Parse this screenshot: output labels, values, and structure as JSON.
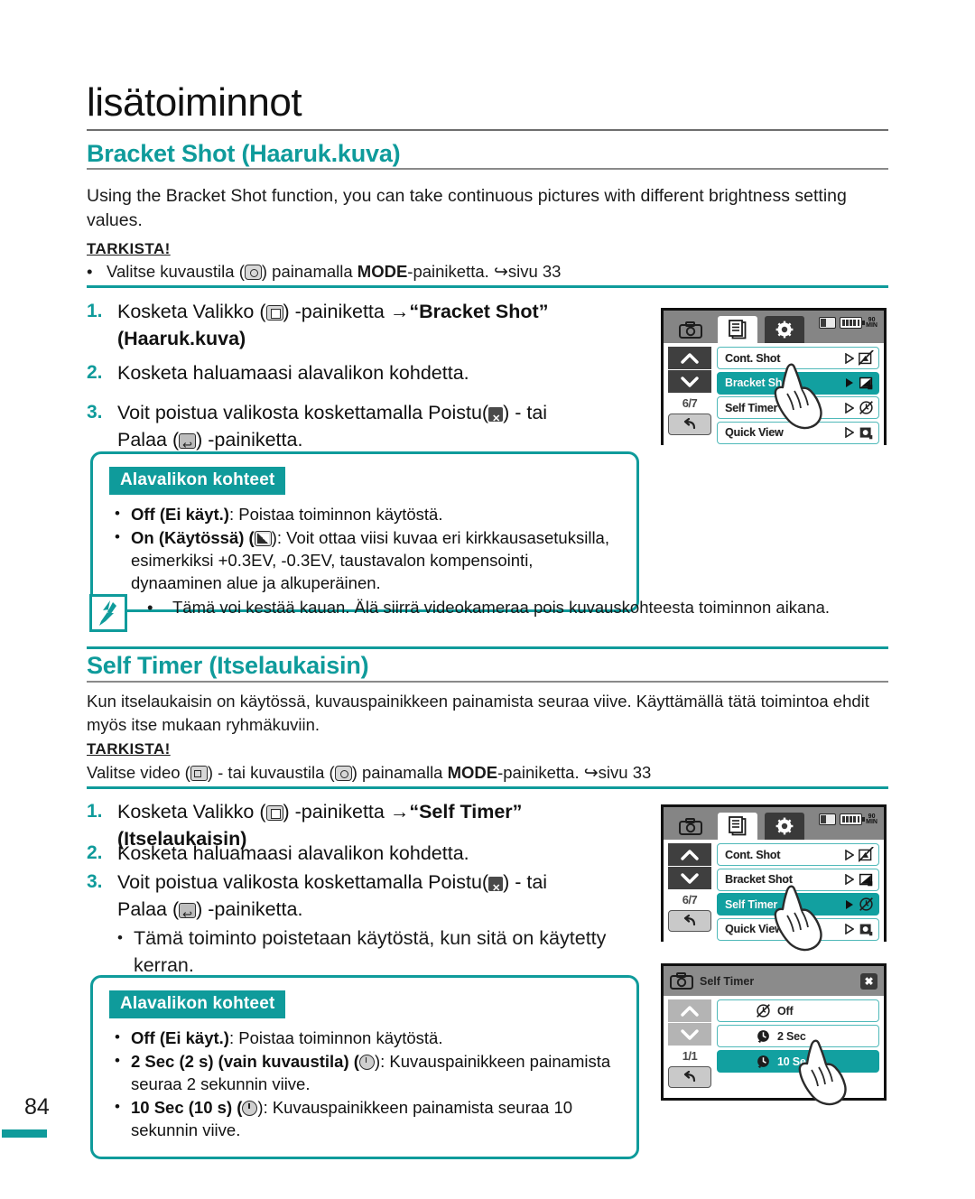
{
  "document": {
    "chapter_title": "lisätoiminnot",
    "page_number": "84"
  },
  "section1": {
    "heading": "Bracket Shot (Haaruk.kuva)",
    "intro": "Using the Bracket Shot function, you can take continuous pictures with different brightness setting values.",
    "tarkista_label": "TARKISTA!",
    "tarkista_text_a": "Valitse kuvaustila (",
    "tarkista_text_b": ") painamalla ",
    "tarkista_bold": "MODE",
    "tarkista_text_c": "-painiketta. ",
    "tarkista_page_ref": "sivu 33",
    "steps": [
      {
        "num": "1.",
        "text_a": "Kosketa Valikko (",
        "text_b": ") -painiketta ",
        "arrow": "→",
        "bold": "“Bracket Shot”",
        "text_c": "(Haaruk.kuva)"
      },
      {
        "num": "2.",
        "text": "Kosketa haluamaasi alavalikon kohdetta."
      },
      {
        "num": "3.",
        "text_a": "Voit poistua valikosta koskettamalla Poistu(",
        "text_b": ") - tai",
        "text_c": "Palaa (",
        "text_d": ") -painiketta."
      }
    ],
    "submenu_box": {
      "title": "Alavalikon kohteet",
      "items": [
        {
          "bold": "Off (Ei käyt.)",
          "rest": ": Poistaa toiminnon käytöstä."
        },
        {
          "bold": "On (Käytössä) (",
          "icon": "ev-icon",
          "rest": "): Voit ottaa viisi kuvaa eri kirkkausasetuksilla, esimerkiksi +0.3EV, -0.3EV, taustavalon kompensointi, dynaaminen alue ja alkuperäinen."
        }
      ]
    },
    "note": {
      "bullet": "•",
      "text": "Tämä voi kestää kauan. Älä siirrä videokameraa pois kuvauskohteesta toiminnon aikana."
    }
  },
  "section2": {
    "heading": "Self Timer (Itselaukaisin)",
    "intro": "Kun itselaukaisin on käytössä, kuvauspainikkeen painamista seuraa viive. Käyttämällä tätä toimintoa ehdit myös itse mukaan ryhmäkuviin.",
    "tarkista_label": "TARKISTA!",
    "tarkista_text_a": "Valitse video (",
    "tarkista_text_b": ") - tai kuvaustila (",
    "tarkista_text_c": ") painamalla ",
    "tarkista_bold": "MODE",
    "tarkista_text_d": "-painiketta. ",
    "tarkista_page_ref": "sivu 33",
    "steps": [
      {
        "num": "1.",
        "text_a": "Kosketa Valikko (",
        "text_b": ") -painiketta ",
        "arrow": "→",
        "bold": "“Self Timer”",
        "text_c": "(Itselaukaisin)"
      },
      {
        "num": "2.",
        "text": "Kosketa haluamaasi alavalikon kohdetta."
      },
      {
        "num": "3.",
        "text_a": "Voit poistua valikosta koskettamalla Poistu(",
        "text_b": ") - tai",
        "text_c": "Palaa (",
        "text_d": ") -painiketta."
      }
    ],
    "sub_note": "Tämä toiminto poistetaan käytöstä, kun sitä on käytetty kerran.",
    "submenu_box": {
      "title": "Alavalikon kohteet",
      "items": [
        {
          "bold": "Off (Ei käyt.)",
          "rest": ": Poistaa toiminnon käytöstä."
        },
        {
          "bold": "2 Sec (2 s) (vain kuvaustila) (",
          "icon": "timer-icon",
          "rest": "): Kuvauspainikkeen painamista seuraa 2 sekunnin viive."
        },
        {
          "bold": "10 Sec (10 s) (",
          "icon": "timer-icon",
          "rest": "): Kuvauspainikkeen painamista seuraa 10 sekunnin viive."
        }
      ]
    }
  },
  "lcd_screens": [
    {
      "id": "bracket-shot-menu",
      "tabs": [
        "camera-tab-icon",
        "menu-tab-icon",
        "settings-tab-icon"
      ],
      "active_tab_index": 1,
      "status": {
        "sd": "sd-card-icon",
        "battery": "battery-icon",
        "time_remaining": "90",
        "time_unit": "MIN"
      },
      "page_indicator": "6/7",
      "rows": [
        {
          "label": "Cont. Shot",
          "selected": false,
          "glyph": "cont-shot-off-icon"
        },
        {
          "label": "Bracket Shot",
          "selected": true,
          "glyph": "bracket-shot-icon"
        },
        {
          "label": "Self Timer",
          "selected": false,
          "glyph": "self-timer-off-icon"
        },
        {
          "label": "Quick View",
          "selected": false,
          "glyph": "quick-view-icon"
        }
      ],
      "hand_on_row": 1
    },
    {
      "id": "self-timer-menu",
      "tabs": [
        "camera-tab-icon",
        "menu-tab-icon",
        "settings-tab-icon"
      ],
      "active_tab_index": 1,
      "status": {
        "sd": "sd-card-icon",
        "battery": "battery-icon",
        "time_remaining": "90",
        "time_unit": "MIN"
      },
      "page_indicator": "6/7",
      "rows": [
        {
          "label": "Cont. Shot",
          "selected": false,
          "glyph": "cont-shot-off-icon"
        },
        {
          "label": "Bracket Shot",
          "selected": false,
          "glyph": "bracket-shot-icon"
        },
        {
          "label": "Self Timer",
          "selected": true,
          "glyph": "self-timer-off-icon"
        },
        {
          "label": "Quick View",
          "selected": false,
          "glyph": "quick-view-icon"
        }
      ],
      "hand_on_row": 2
    },
    {
      "id": "self-timer-submenu",
      "title": "Self Timer",
      "title_icon": "camera-mode-icon",
      "close_label": "✖",
      "page_indicator": "1/1",
      "rows": [
        {
          "label": "Off",
          "selected": false,
          "glyph": "timer-off-icon",
          "checked": false
        },
        {
          "label": "2 Sec",
          "selected": false,
          "glyph": "timer-2s-icon",
          "checked": false
        },
        {
          "label": "10 Sec",
          "selected": true,
          "glyph": "timer-10s-icon",
          "checked": true
        }
      ],
      "hand_on_row": 2
    }
  ],
  "colors": {
    "teal": "#0F9B9B",
    "teal_light": "#4FB9B9",
    "lcd_selected": "#12A0A0",
    "header_grey": "#858585"
  }
}
